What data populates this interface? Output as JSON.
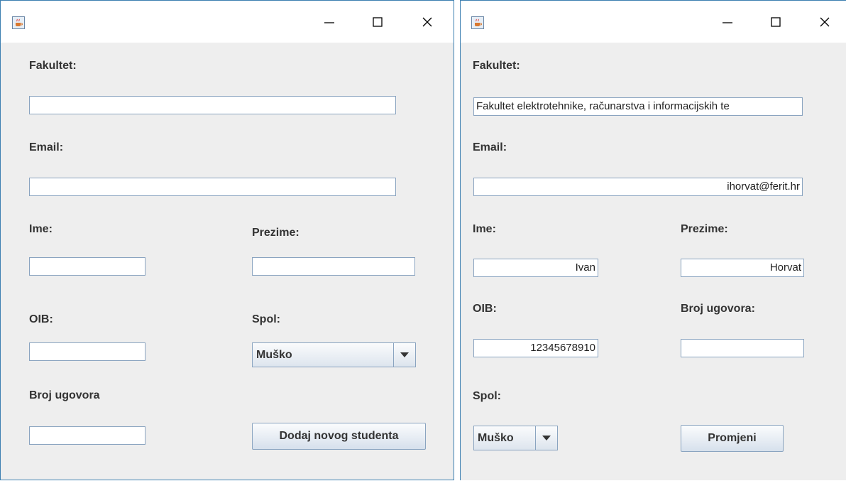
{
  "left_window": {
    "labels": {
      "fakultet": "Fakultet:",
      "email": "Email:",
      "ime": "Ime:",
      "prezime": "Prezime:",
      "oib": "OIB:",
      "spol": "Spol:",
      "broj_ugovora": "Broj ugovora"
    },
    "fields": {
      "fakultet": "",
      "email": "",
      "ime": "",
      "prezime": "",
      "oib": "",
      "broj_ugovora": ""
    },
    "spol_value": "Muško",
    "submit_label": "Dodaj novog studenta"
  },
  "right_window": {
    "labels": {
      "fakultet": "Fakultet:",
      "email": "Email:",
      "ime": "Ime:",
      "prezime": "Prezime:",
      "oib": "OIB:",
      "broj_ugovora": "Broj ugovora:",
      "spol": "Spol:"
    },
    "fields": {
      "fakultet": "Fakultet elektrotehnike, računarstva i informacijskih te",
      "email": "ihorvat@ferit.hr",
      "ime": "Ivan",
      "prezime": "Horvat",
      "oib": "12345678910",
      "broj_ugovora": ""
    },
    "spol_value": "Muško",
    "submit_label": "Promjeni"
  },
  "icons": {
    "app": "java-cup-icon",
    "minimize": "minimize-icon",
    "maximize": "maximize-icon",
    "close": "close-icon",
    "dropdown": "chevron-down-icon"
  }
}
